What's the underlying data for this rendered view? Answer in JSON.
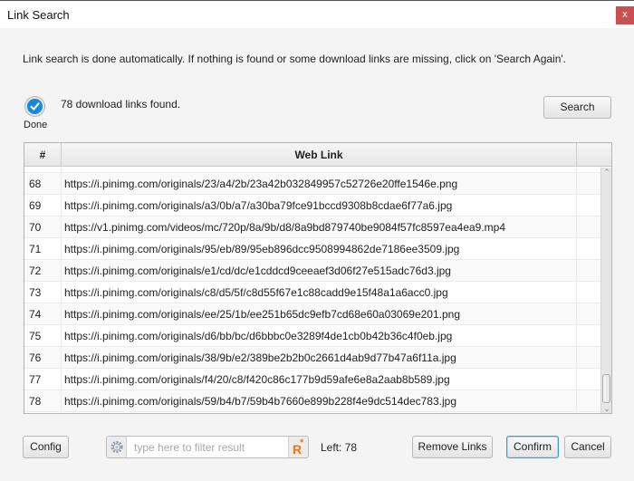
{
  "window": {
    "title": "Link Search",
    "close_label": "x"
  },
  "info_text": "Link search is done automatically. If nothing is found or some download links are missing, click on 'Search Again'.",
  "status": {
    "label": "Done",
    "icon": "check-circle-icon",
    "message": "78 download links found.",
    "accent_color": "#1e88d6"
  },
  "search_button": "Search",
  "table": {
    "columns": [
      "#",
      "Web Link",
      ""
    ],
    "rows": [
      {
        "num": "68",
        "link": "https://i.pinimg.com/originals/23/a4/2b/23a42b032849957c52726e20ffe1546e.png"
      },
      {
        "num": "69",
        "link": "https://i.pinimg.com/originals/a3/0b/a7/a30ba79fce91bccd9308b8cdae6f77a6.jpg"
      },
      {
        "num": "70",
        "link": "https://v1.pinimg.com/videos/mc/720p/8a/9b/d8/8a9bd879740be9084f57fc8597ea4ea9.mp4"
      },
      {
        "num": "71",
        "link": "https://i.pinimg.com/originals/95/eb/89/95eb896dcc9508994862de7186ee3509.jpg"
      },
      {
        "num": "72",
        "link": "https://i.pinimg.com/originals/e1/cd/dc/e1cddcd9ceeaef3d06f27e515adc76d3.jpg"
      },
      {
        "num": "73",
        "link": "https://i.pinimg.com/originals/c8/d5/5f/c8d55f67e1c88cadd9e15f48a1a6acc0.jpg"
      },
      {
        "num": "74",
        "link": "https://i.pinimg.com/originals/ee/25/1b/ee251b65dc9efb7cd68e60a03069e201.png"
      },
      {
        "num": "75",
        "link": "https://i.pinimg.com/originals/d6/bb/bc/d6bbbc0e3289f4de1cb0b42b36c4f0eb.jpg"
      },
      {
        "num": "76",
        "link": "https://i.pinimg.com/originals/38/9b/e2/389be2b2b0c2661d4ab9d77b47a6f11a.jpg"
      },
      {
        "num": "77",
        "link": "https://i.pinimg.com/originals/f4/20/c8/f420c86c177b9d59afe6e8a2aab8b589.jpg"
      },
      {
        "num": "78",
        "link": "https://i.pinimg.com/originals/59/b4/b7/59b4b7660e899b228f4e9dc514dec783.jpg"
      }
    ]
  },
  "footer": {
    "config_button": "Config",
    "filter_placeholder": "type here to filter result",
    "filter_value": "",
    "left_count": "Left: 78",
    "remove_links_button": "Remove Links",
    "confirm_button": "Confirm",
    "cancel_button": "Cancel"
  }
}
